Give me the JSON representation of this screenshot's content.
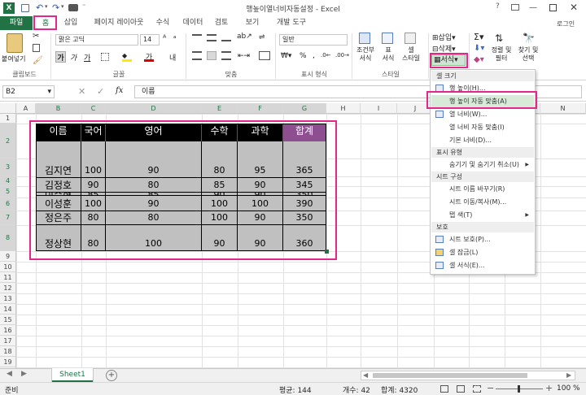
{
  "app": {
    "title": "행높이열너비자동설정 - Excel",
    "help": "?",
    "user": "로그인"
  },
  "tabs": [
    {
      "label": "파일"
    },
    {
      "label": "홈"
    },
    {
      "label": "삽입"
    },
    {
      "label": "페이지 레이아웃"
    },
    {
      "label": "수식"
    },
    {
      "label": "데이터"
    },
    {
      "label": "검토"
    },
    {
      "label": "보기"
    },
    {
      "label": "개발 도구"
    }
  ],
  "ribbon": {
    "paste": "붙여넣기",
    "font_name": "맑은 고딕",
    "font_size": "14",
    "number_format": "일반",
    "conditional": "조건부\n서식",
    "table": "표\n서식",
    "cell_style": "셀\n스타일",
    "insert": "삽입",
    "delete": "삭제",
    "format": "서식",
    "sort": "정렬 및\n필터",
    "find": "찾기 및\n선택",
    "groups": [
      "클립보드",
      "글꼴",
      "맞춤",
      "표시 형식",
      "스타일",
      "셀",
      "편집"
    ]
  },
  "formula": {
    "name_box": "B2",
    "fx": "fx",
    "value": "이름"
  },
  "columns": [
    "A",
    "B",
    "C",
    "D",
    "E",
    "F",
    "G",
    "H",
    "I",
    "J",
    "K",
    "L",
    "M",
    "N"
  ],
  "rows": [
    "1",
    "2",
    "3",
    "4",
    "5",
    "6",
    "7",
    "8",
    "9",
    "10",
    "11",
    "12",
    "13",
    "14",
    "15",
    "16",
    "17",
    "18",
    "19",
    "20",
    "21",
    "22"
  ],
  "table": {
    "headers": [
      "이름",
      "국어",
      "영어",
      "수학",
      "과학",
      "합계"
    ],
    "rows": [
      [
        "김지연",
        "100",
        "90",
        "80",
        "95",
        "365"
      ],
      [
        "김정호",
        "90",
        "80",
        "85",
        "90",
        "345"
      ],
      [
        "이수현",
        "85",
        "85",
        "90",
        "90",
        "350"
      ],
      [
        "이성훈",
        "100",
        "90",
        "100",
        "100",
        "390"
      ],
      [
        "정은주",
        "80",
        "80",
        "100",
        "90",
        "350"
      ],
      [
        "정상현",
        "80",
        "100",
        "90",
        "90",
        "360"
      ]
    ]
  },
  "menu": {
    "sections": [
      {
        "title": "셀 크기",
        "items": [
          "행 높이(H)...",
          "행 높이 자동 맞춤(A)",
          "열 너비(W)...",
          "열 너비 자동 맞춤(I)",
          "기본 너비(D)..."
        ]
      },
      {
        "title": "표시 유형",
        "items": [
          "숨기기 및 숨기기 취소(U)"
        ]
      },
      {
        "title": "시트 구성",
        "items": [
          "시트 이름 바꾸기(R)",
          "시트 이동/복사(M)...",
          "탭 색(T)"
        ]
      },
      {
        "title": "보호",
        "items": [
          "시트 보호(P)...",
          "셀 잠금(L)",
          "셀 서식(E)..."
        ]
      }
    ]
  },
  "sheet": {
    "tab": "Sheet1",
    "add": "+"
  },
  "status": {
    "mode": "준비",
    "avg": "평균: 144",
    "count": "개수: 42",
    "sum": "합계: 4320",
    "zoom": "100 %"
  },
  "colors": {
    "excel_green": "#217346",
    "highlight": "#e5278b",
    "header_black": "#000000",
    "total_purple": "#8e4f91",
    "cell_gray": "#c0c0c0",
    "menu_hover": "#d8ebd9"
  }
}
